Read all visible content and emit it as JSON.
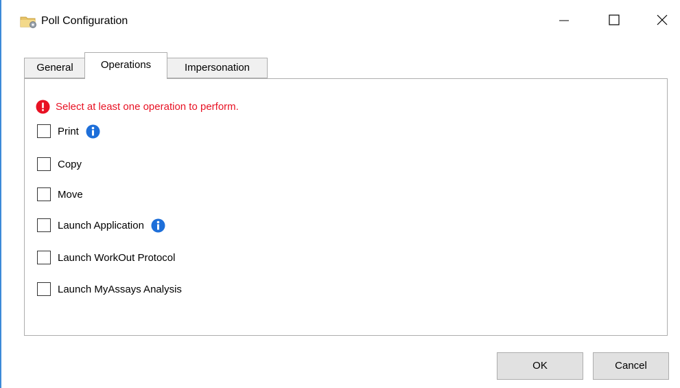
{
  "window": {
    "title": "Poll Configuration",
    "icon": "folder-gears-icon",
    "controls": [
      "minimize-icon",
      "maximize-icon",
      "close-icon"
    ]
  },
  "tabs": [
    {
      "label": "General",
      "selected": false
    },
    {
      "label": "Operations",
      "selected": true
    },
    {
      "label": "Impersonation",
      "selected": false
    }
  ],
  "validation": {
    "message": "Select at least one operation to perform.",
    "icon": "error-icon",
    "color": "#e81123"
  },
  "operations": [
    {
      "label": "Print",
      "checked": false,
      "has_info": true
    },
    {
      "label": "Copy",
      "checked": false,
      "has_info": false
    },
    {
      "label": "Move",
      "checked": false,
      "has_info": false
    },
    {
      "label": "Launch Application",
      "checked": false,
      "has_info": true
    },
    {
      "label": "Launch WorkOut Protocol",
      "checked": false,
      "has_info": false
    },
    {
      "label": "Launch MyAssays Analysis",
      "checked": false,
      "has_info": false
    }
  ],
  "buttons": {
    "ok": "OK",
    "cancel": "Cancel"
  },
  "colors": {
    "window_border": "#3c8ad8",
    "info_blue": "#1e6fd9"
  }
}
